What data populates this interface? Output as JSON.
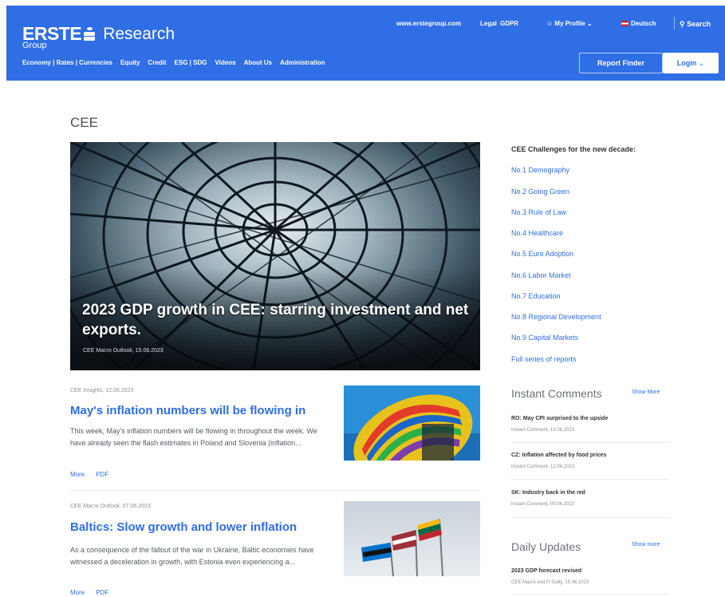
{
  "header": {
    "brand": "ERSTE",
    "title": "Research",
    "group": "Group",
    "utility": {
      "site_link": "www.erstegroup.com",
      "legal": "Legal",
      "gdpr": "GDPR",
      "profile": "My Profile",
      "language": "Deutsch",
      "search": "Search"
    },
    "nav": [
      "Economy | Rates | Currencies",
      "Equity",
      "Credit",
      "ESG | SDG",
      "Videos",
      "About Us",
      "Administration"
    ],
    "report_finder": "Report Finder",
    "login": "Login"
  },
  "page": {
    "title": "CEE"
  },
  "hero": {
    "title": "2023 GDP growth in CEE: starring investment and net exports.",
    "meta": "CEE Macro Outlook, 15.06.2023"
  },
  "challenges": {
    "heading": "CEE Challenges for the new decade:",
    "items": [
      "No.1 Demography",
      "No.2 Going Green",
      "No.3 Rule of Law",
      "No.4 Healthcare",
      "No.5 Euro Adoption",
      "No.6 Labor Market",
      "No.7 Education",
      "No.8 Regional Development",
      "No.9 Capital Markets",
      "Full series of reports"
    ]
  },
  "articles": [
    {
      "meta": "CEE Insights, 12.06.2023",
      "title": "May's inflation numbers will be flowing in",
      "excerpt": "This week, May's inflation numbers will be flowing in throughout the week. We have already seen the flash estimates in Poland and Slovenia (inflation...",
      "more": "More",
      "pdf": "PDF"
    },
    {
      "meta": "CEE Macro Outlook, 07.06.2023",
      "title": "Baltics: Slow growth and lower inflation",
      "excerpt": "As a consequence of the fallout of the war in Ukraine, Baltic economies have witnessed a deceleration in growth, with Estonia even experiencing a...",
      "more": "More",
      "pdf": "PDF"
    }
  ],
  "instant_comments": {
    "title": "Instant Comments",
    "show_more": "Show More",
    "items": [
      {
        "title": "RO: May CPI surprised to the upside",
        "meta": "Instant Comment, 13.06.2023"
      },
      {
        "title": "CZ: Inflation affected by food prices",
        "meta": "Instant Comment, 12.06.2023"
      },
      {
        "title": "SK: Industry back in the red",
        "meta": "Instant Comment, 09.06.2023"
      }
    ]
  },
  "daily_updates": {
    "title": "Daily Updates",
    "show_more": "Show more",
    "items": [
      {
        "title": "2023 GDP forecast revised",
        "meta": "CEE Macro and FI Daily, 15.06.2023"
      }
    ]
  },
  "colors": {
    "brand_blue": "#2f6ee5",
    "text": "#3a3f4a",
    "muted": "#8a8f98"
  }
}
